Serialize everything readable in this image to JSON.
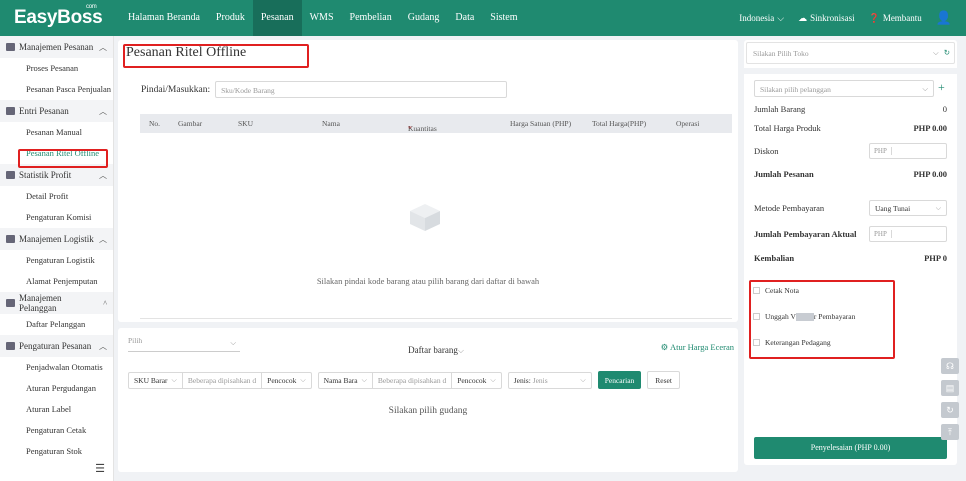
{
  "brand": {
    "logo": "EasyBoss",
    "logo_sup": "com"
  },
  "nav": {
    "items": [
      "Halaman Beranda",
      "Produk",
      "Pesanan",
      "WMS",
      "Pembelian",
      "Gudang",
      "Data",
      "Sistem"
    ],
    "active": "Pesanan"
  },
  "topright": {
    "language": "Indonesia",
    "sync": "Sinkronisasi",
    "help": "Membantu"
  },
  "sidebar": {
    "group1": "Manajemen Pesanan",
    "g1_items": [
      "Proses Pesanan",
      "Pesanan Pasca Penjualan"
    ],
    "group2": "Entri Pesanan",
    "g2_items": [
      "Pesanan Manual",
      "Pesanan Ritel Offline"
    ],
    "group3": "Statistik Profit",
    "g3_items": [
      "Detail Profit",
      "Pengaturan Komisi"
    ],
    "group4": "Manajemen Logistik",
    "g4_items": [
      "Pengaturan Logistik",
      "Alamat Penjemputan"
    ],
    "group5": "Manajemen Pelanggan",
    "g5_items": [
      "Daftar Pelanggan"
    ],
    "group6": "Pengaturan Pesanan",
    "g6_items": [
      "Penjadwalan Otomatis",
      "Aturan Pergudangan",
      "Aturan Label",
      "Pengaturan Cetak",
      "Pengaturan Stok"
    ]
  },
  "main": {
    "title": "Pesanan Ritel Offline",
    "scan_label": "Pindai/Masukkan:",
    "scan_placeholder": "Sku/Kode Barang",
    "columns": [
      "No.",
      "Gambar",
      "SKU",
      "Nama",
      "Kuantitas",
      "Harga Satuan (PHP)",
      "Total Harga(PHP)",
      "Operasi"
    ],
    "required_mark": "*",
    "empty_text": "Silakan pindai kode barang atau pilih barang dari daftar di bawah"
  },
  "lower": {
    "pilih": "Pilih",
    "tab": "Daftar barang",
    "atur": "Atur Harga Eceran",
    "f1_select": "SKU Barar",
    "f1_placeholder": "Beberapa dipisahkan d",
    "f1_mode": "Pencocok",
    "f2_select": "Nama Bara",
    "f2_placeholder": "Beberapa dipisahkan d",
    "f2_mode": "Pencocok",
    "f3_label": "Jenis:",
    "f3_value": "Jenis",
    "search": "Pencarian",
    "reset": "Reset",
    "empty": "Silakan pilih gudang"
  },
  "right": {
    "store_placeholder": "Silakan Pilih Toko",
    "customer_placeholder": "Silakan pilih pelanggan",
    "jumlah_barang_label": "Jumlah Barang",
    "jumlah_barang": "0",
    "total_label": "Total Harga Produk",
    "total": "PHP 0.00",
    "diskon_label": "Diskon",
    "currency": "PHP",
    "jumlah_pesanan_label": "Jumlah Pesanan",
    "jumlah_pesanan": "PHP 0.00",
    "metode_label": "Metode Pembayaran",
    "metode": "Uang Tunai",
    "aktual_label": "Jumlah Pembayaran Aktual",
    "kembalian_label": "Kembalian",
    "kembalian": "PHP 0",
    "chk1": "Cetak Nota",
    "chk2_pre": "Unggah V",
    "chk2_post": "r Pembayaran",
    "chk3": "Keterangan Pedagang",
    "settle": "Penyelesaian (PHP 0.00)"
  },
  "colors": {
    "brand": "#1f8a70",
    "highlight": "#e02020"
  }
}
